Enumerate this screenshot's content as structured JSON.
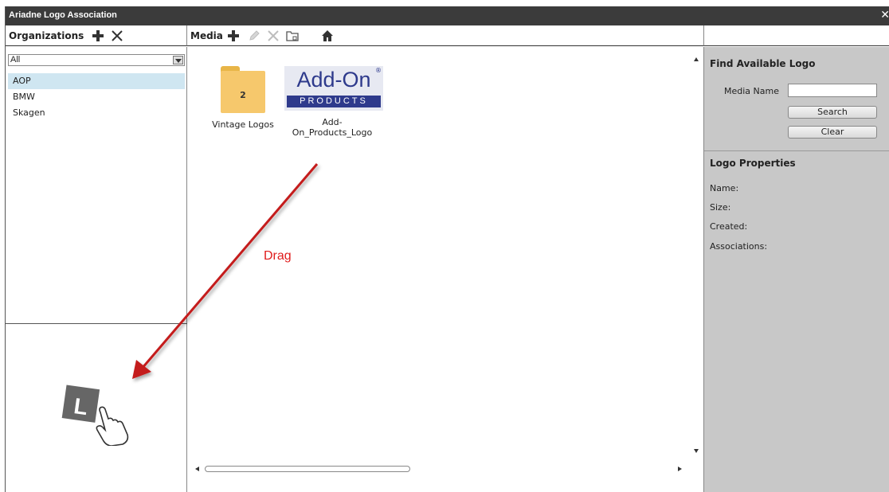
{
  "window": {
    "title": "Ariadne Logo Association",
    "close_glyph": "✕"
  },
  "organizations": {
    "header": "Organizations",
    "filter_value": "All",
    "items": [
      "AOP",
      "BMW",
      "Skagen"
    ],
    "selected": "AOP"
  },
  "media": {
    "header": "Media",
    "tiles": [
      {
        "caption": "Vintage Logos",
        "count": "2",
        "icon": "folder-icon"
      },
      {
        "caption": "Add-\nOn_Products_Logo",
        "icon": "add-on-products-logo",
        "logo_text": "Add-On",
        "logo_band": "PRODUCTS"
      }
    ]
  },
  "find_logo": {
    "title": "Find Available Logo",
    "media_name_label": "Media Name",
    "media_name_value": "",
    "search_label": "Search",
    "clear_label": "Clear"
  },
  "logo_properties": {
    "title": "Logo Properties",
    "name_label": "Name:",
    "size_label": "Size:",
    "created_label": "Created:",
    "associations_label": "Associations:"
  },
  "annotation": {
    "drag_label": "Drag",
    "color": "#e01b1b",
    "l_glyph": "L"
  },
  "colors": {
    "titlebar": "#3b3b3b",
    "selected_row": "#cfe6f1",
    "right_pane": "#c8c8c8",
    "logo_blue": "#2e3a8c",
    "folder": "#f6c86c"
  }
}
